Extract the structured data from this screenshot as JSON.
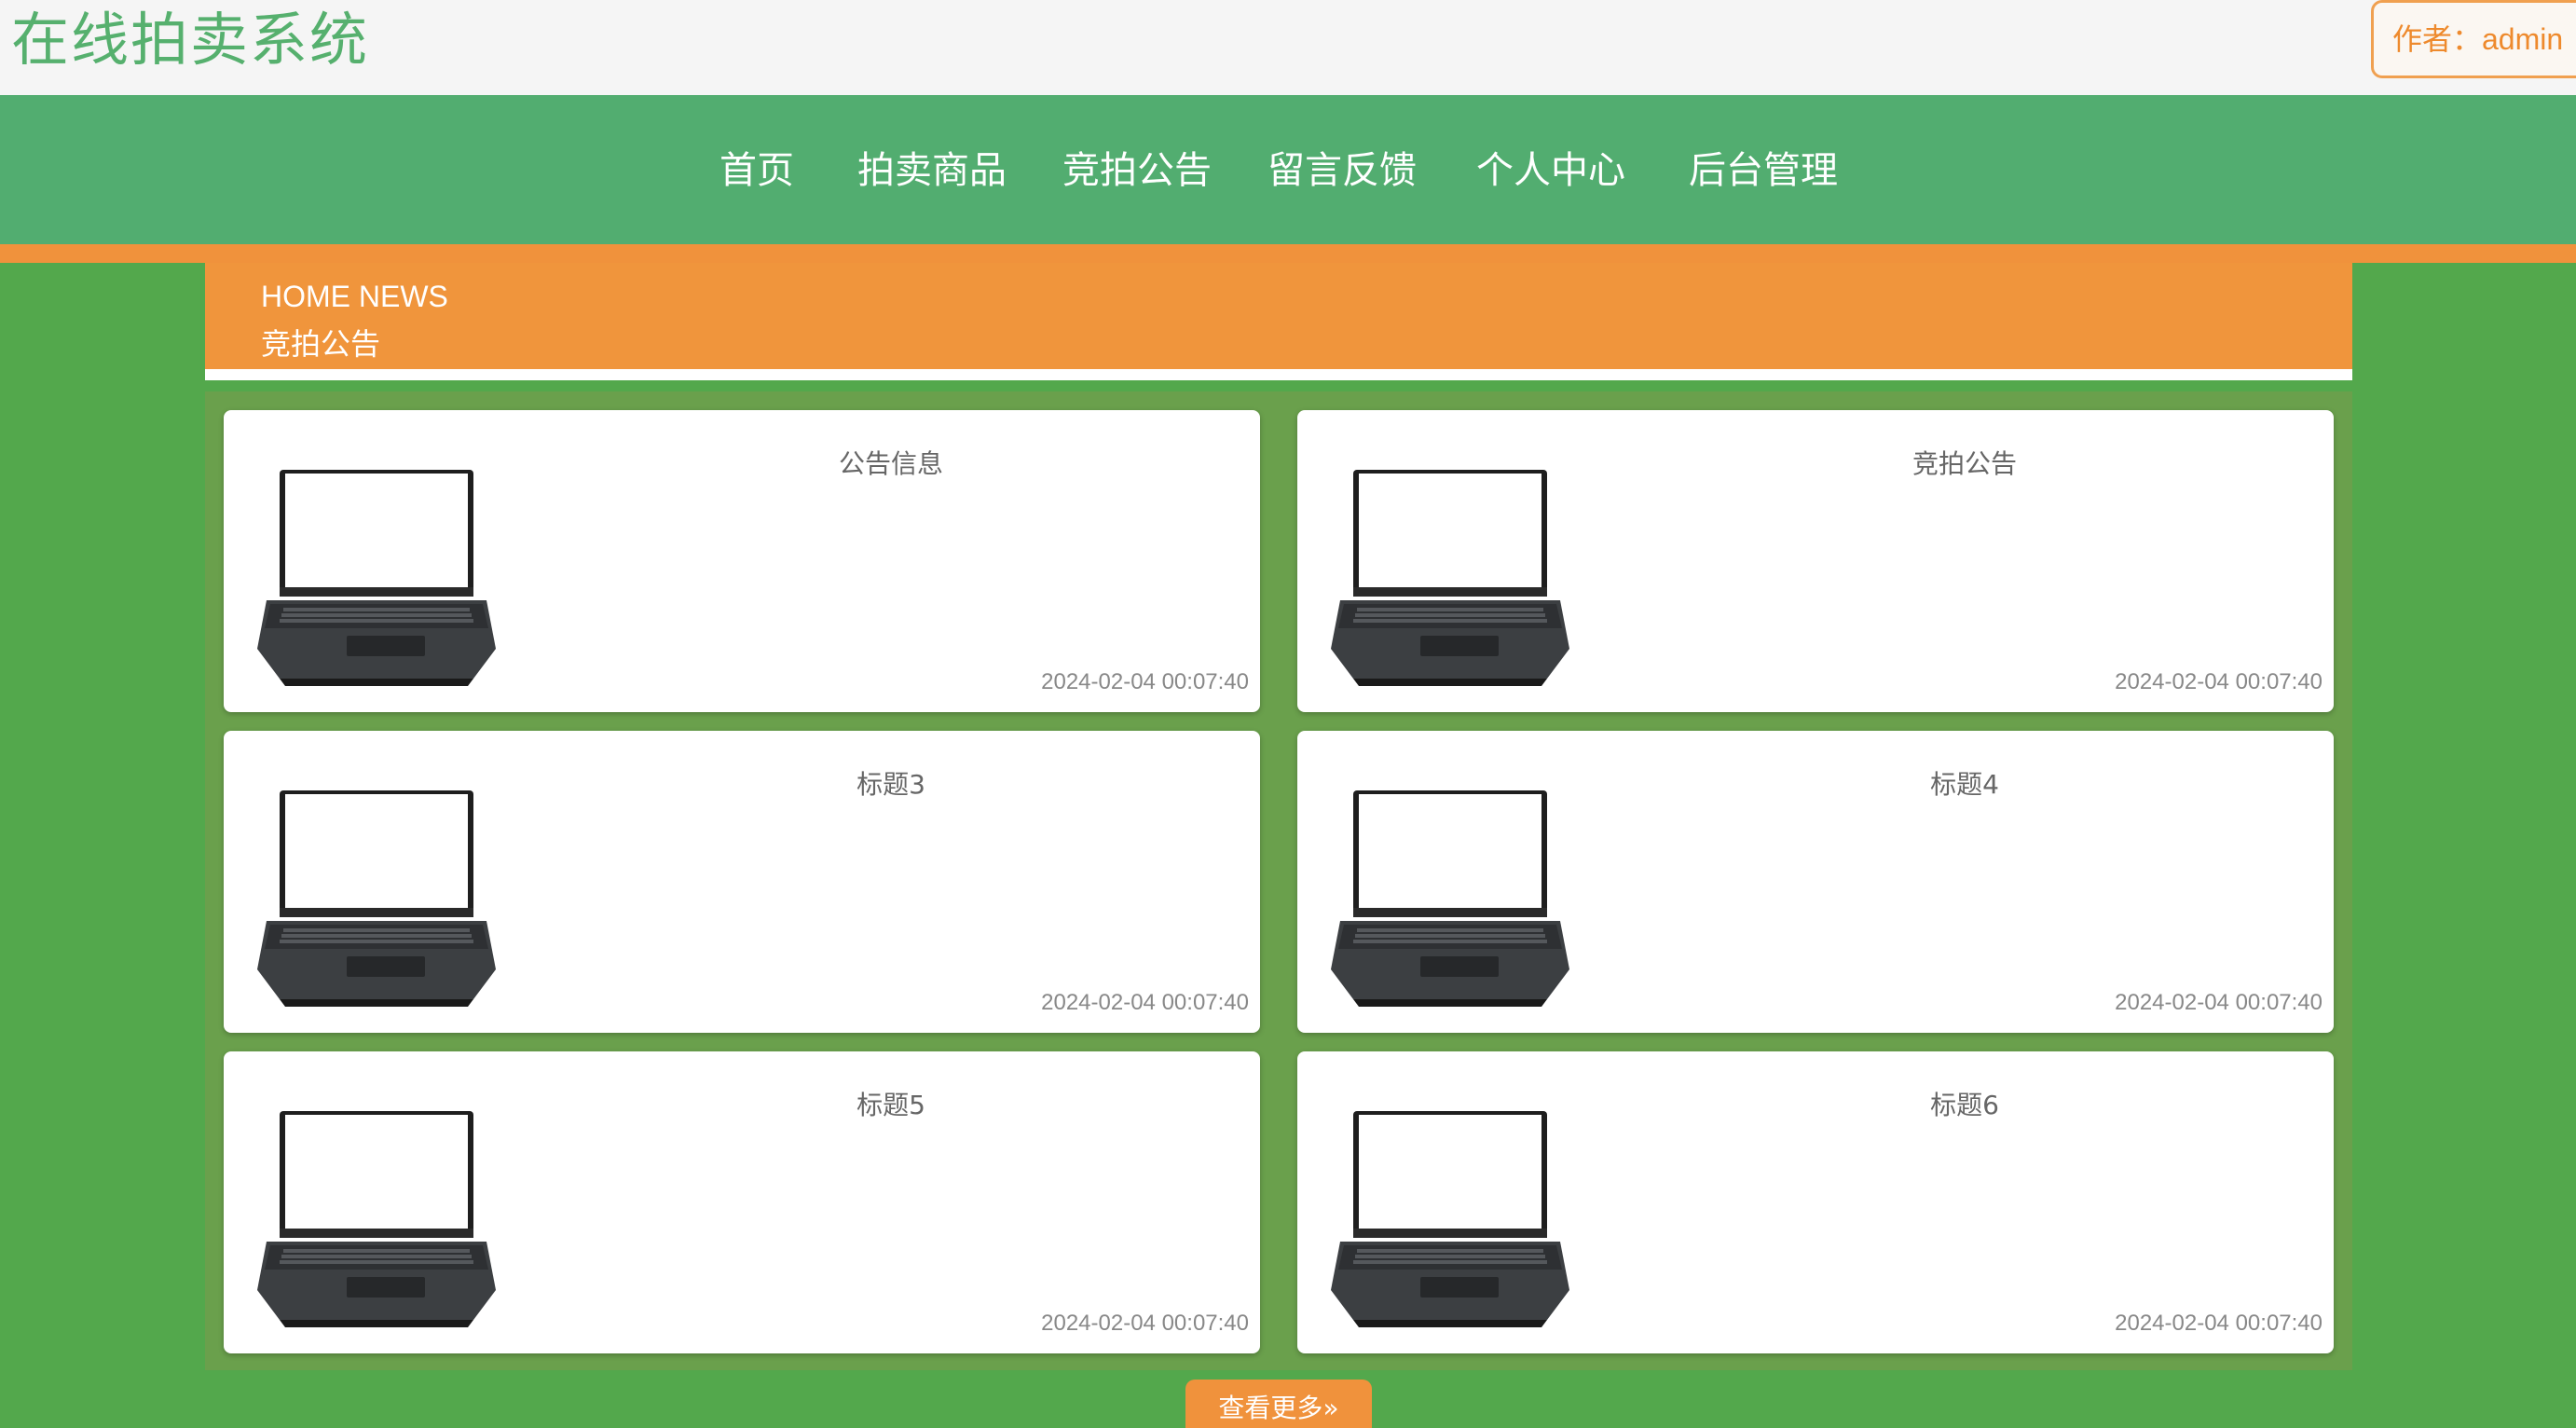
{
  "header": {
    "site_title": "在线拍卖系统",
    "author_label": "作者：admin"
  },
  "nav": {
    "items": [
      {
        "label": "首页"
      },
      {
        "label": "拍卖商品"
      },
      {
        "label": "竞拍公告"
      },
      {
        "label": "留言反馈"
      },
      {
        "label": "个人中心"
      },
      {
        "label": "后台管理"
      }
    ]
  },
  "news_section": {
    "title_en": "HOME NEWS",
    "title_zh": "竞拍公告"
  },
  "cards": [
    {
      "title": "公告信息",
      "date": "2024-02-04 00:07:40",
      "image": "laptop-image"
    },
    {
      "title": "竞拍公告",
      "date": "2024-02-04 00:07:40",
      "image": "laptop-image"
    },
    {
      "title": "标题3",
      "date": "2024-02-04 00:07:40",
      "image": "laptop-image"
    },
    {
      "title": "标题4",
      "date": "2024-02-04 00:07:40",
      "image": "laptop-image"
    },
    {
      "title": "标题5",
      "date": "2024-02-04 00:07:40",
      "image": "laptop-image"
    },
    {
      "title": "标题6",
      "date": "2024-02-04 00:07:40",
      "image": "laptop-image"
    }
  ],
  "more_button": {
    "label": "查看更多",
    "icon": "double-chevron-right-icon"
  },
  "colors": {
    "page_background": "#53a84c",
    "nav_background": "#52ad70",
    "accent_orange": "#f0923c",
    "title_green": "#56b06e"
  }
}
